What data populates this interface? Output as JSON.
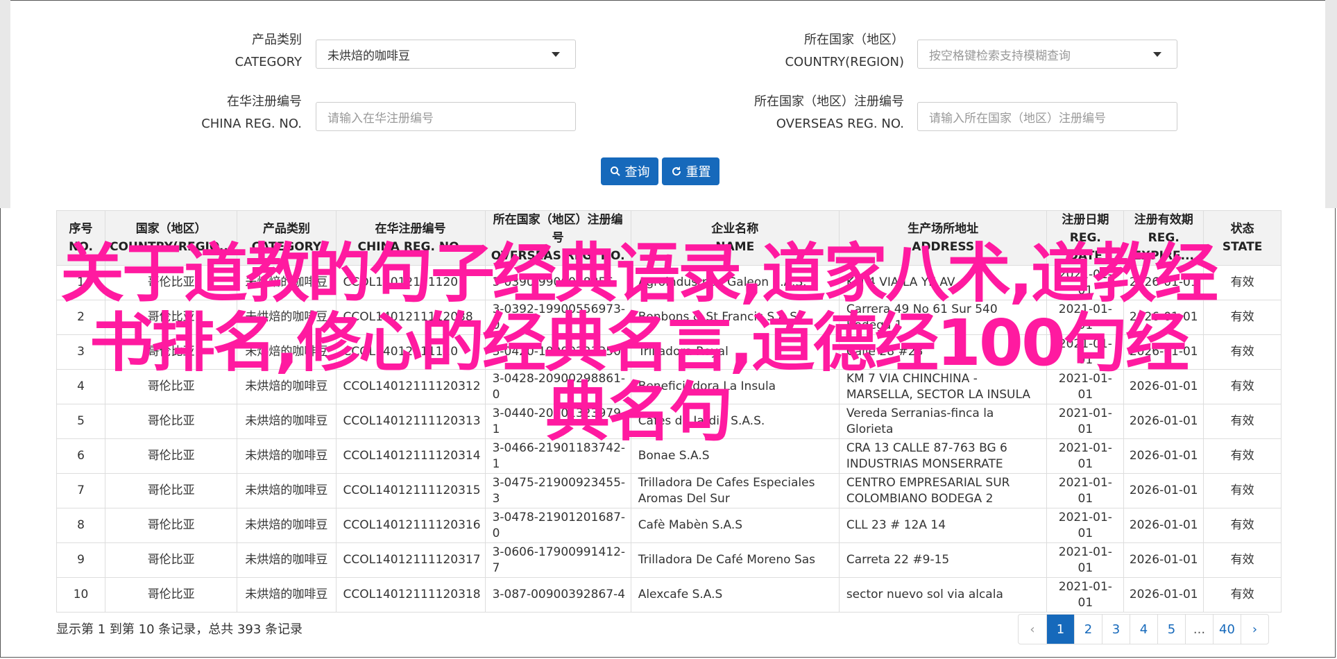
{
  "filters": {
    "category": {
      "label_cn": "产品类别",
      "label_en": "CATEGORY",
      "value": "未烘焙的咖啡豆"
    },
    "country": {
      "label_cn": "所在国家（地区）",
      "label_en": "COUNTRY(REGION)",
      "placeholder": "按空格键检索支持模糊查询"
    },
    "china_reg": {
      "label_cn": "在华注册编号",
      "label_en": "CHINA REG. NO.",
      "placeholder": "请输入在华注册编号"
    },
    "overseas_reg": {
      "label_cn": "所在国家（地区）注册编号",
      "label_en": "OVERSEAS REG. NO.",
      "placeholder": "请输入所在国家（地区）注册编号"
    }
  },
  "buttons": {
    "search": "查询",
    "reset": "重置"
  },
  "table": {
    "headers": [
      {
        "cn": "序号",
        "en": "NO."
      },
      {
        "cn": "国家（地区）",
        "en": "COUNTRY(REGIO..."
      },
      {
        "cn": "产品类别",
        "en": "CATEGORY"
      },
      {
        "cn": "在华注册编号",
        "en": "CHINA REG. NO."
      },
      {
        "cn": "所在国家（地区）注册编号",
        "en": "OVERSEAS REG. NO."
      },
      {
        "cn": "企业名称",
        "en": "NAME"
      },
      {
        "cn": "生产场所地址",
        "en": "ADDRESS"
      },
      {
        "cn": "注册日期",
        "en": "REG. DATE"
      },
      {
        "cn": "注册有效期",
        "en": "REG. EXPIRE..."
      },
      {
        "cn": "状态",
        "en": "STATE"
      }
    ],
    "rows": [
      [
        "1",
        "哥伦比亚",
        "未烘焙的咖啡豆",
        "CCOL14012111120",
        "3-0390-9900048856",
        "Agroindustrias Galeon S.A.S.",
        "KM 4 VIA LA YE AV",
        "2021-01-01",
        "2026-01-01",
        "有效"
      ],
      [
        "2",
        "哥伦比亚",
        "未烘焙的咖啡豆",
        "CCOL1401211112038",
        "3-0392-19900556973-0",
        "Bonbons & St Francis S.A.S.",
        "Carrera 49 No 61 Sur 540 Bodega 1",
        "2021-01-01",
        "2026-01-01",
        "有效"
      ],
      [
        "3",
        "哥伦比亚",
        "未烘焙的咖啡豆",
        "CCOL14012111120",
        "3-0420-19900223350",
        "Trilladora Royal",
        "Calle 28 #28",
        "2021-01-01",
        "2026-01-01",
        "有效"
      ],
      [
        "4",
        "哥伦比亚",
        "未烘焙的咖啡豆",
        "CCOL14012111120312",
        "3-0428-20900298861-0",
        "Beneficiadora La Insula",
        "KM 7 VIA CHINCHINA - MARSELLA, SECTOR LA INSULA",
        "2021-01-01",
        "2026-01-01",
        "有效"
      ],
      [
        "5",
        "哥伦比亚",
        "未烘焙的咖啡豆",
        "CCOL14012111120313",
        "3-0440-20901323979-1",
        "Cafes de Jardin S.A.S.",
        "Vereda Serranias-finca la Glorieta",
        "2021-01-01",
        "2026-01-01",
        "有效"
      ],
      [
        "6",
        "哥伦比亚",
        "未烘焙的咖啡豆",
        "CCOL14012111120314",
        "3-0466-21901183742-1",
        "Bonae S.A.S",
        "CRA 13 CALLE 87-763 BG 6 INDUSTRIAS MONSERRATE",
        "2021-01-01",
        "2026-01-01",
        "有效"
      ],
      [
        "7",
        "哥伦比亚",
        "未烘焙的咖啡豆",
        "CCOL14012111120315",
        "3-0475-21900923455-3",
        "Trilladora De Cafes Especiales Aromas Del Sur",
        "CENTRO EMPRESARIAL SUR COLOMBIANO BODEGA 2",
        "2021-01-01",
        "2026-01-01",
        "有效"
      ],
      [
        "8",
        "哥伦比亚",
        "未烘焙的咖啡豆",
        "CCOL14012111120316",
        "3-0478-21901201687-0",
        "Cafè Mabèn S.A.S",
        "CLL 23 # 12A 14",
        "2021-01-01",
        "2026-01-01",
        "有效"
      ],
      [
        "9",
        "哥伦比亚",
        "未烘焙的咖啡豆",
        "CCOL14012111120317",
        "3-0606-17900991412-7",
        "Trilladora De Café Moreno Sas",
        "Carreta 22 #9-15",
        "2021-01-01",
        "2026-01-01",
        "有效"
      ],
      [
        "10",
        "哥伦比亚",
        "未烘焙的咖啡豆",
        "CCOL14012111120318",
        "3-087-00900392867-4",
        "Alexcafe S.A.S",
        "sector nuevo sol via alcala",
        "2021-01-01",
        "2026-01-01",
        "有效"
      ]
    ]
  },
  "footer": {
    "summary": "显示第 1 到第 10 条记录，总共 393 条记录",
    "pages": [
      "‹",
      "1",
      "2",
      "3",
      "4",
      "5",
      "...",
      "40",
      "›"
    ],
    "active_page": "1"
  },
  "overlay": {
    "line1": "关于道教的句子经典语录,道家八术,道教经",
    "line2": "书排名,修心的经典名言,道德经100句经",
    "line3": "典名句"
  },
  "colors": {
    "primary": "#1669bb",
    "overlay": "#ff1aa0"
  }
}
